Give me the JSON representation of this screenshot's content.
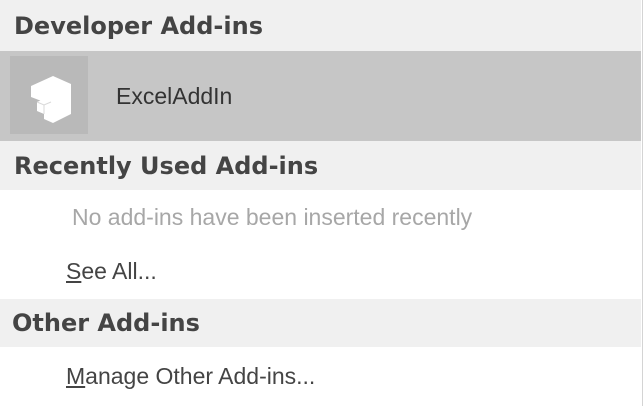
{
  "developer": {
    "header": "Developer Add-ins",
    "addin_name": "ExcelAddIn",
    "addin_icon": "addin-cube-icon"
  },
  "recent": {
    "header": "Recently Used Add-ins",
    "empty_message": "No add-ins have been inserted recently",
    "see_all": {
      "accel": "S",
      "rest": "ee All..."
    }
  },
  "other": {
    "header": "Other Add-ins",
    "manage": {
      "accel": "M",
      "rest": "anage Other Add-ins..."
    }
  },
  "colors": {
    "header_bg": "#f0f0f0",
    "selected_bg": "#c6c6c6",
    "icon_bg": "#b9b9b9",
    "muted_text": "#a7a7a7"
  }
}
